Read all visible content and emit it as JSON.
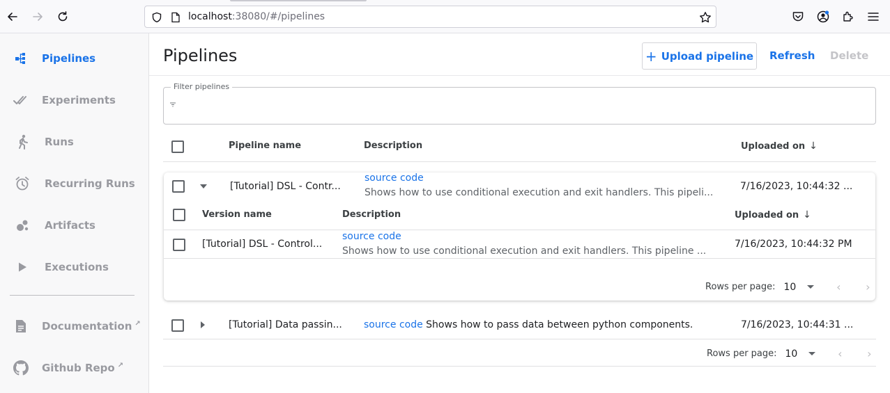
{
  "browser": {
    "url_host": "localhost",
    "url_rest": ":38080/#/pipelines"
  },
  "sidebar": {
    "items": [
      {
        "label": "Pipelines"
      },
      {
        "label": "Experiments"
      },
      {
        "label": "Runs"
      },
      {
        "label": "Recurring Runs"
      },
      {
        "label": "Artifacts"
      },
      {
        "label": "Executions"
      },
      {
        "label": "Documentation"
      },
      {
        "label": "Github Repo"
      }
    ]
  },
  "header": {
    "title": "Pipelines",
    "upload_label": "Upload pipeline",
    "refresh_label": "Refresh",
    "delete_label": "Delete"
  },
  "filter": {
    "legend": "Filter pipelines",
    "value": ""
  },
  "table": {
    "columns": {
      "name": "Pipeline name",
      "description": "Description",
      "uploaded": "Uploaded on"
    },
    "rows": [
      {
        "name": "[Tutorial] DSL - Contr...",
        "link": "source code",
        "description": "Shows how to use conditional execution and exit handlers. This pipeli...",
        "uploaded": "7/16/2023, 10:44:32 ..."
      },
      {
        "name": "[Tutorial] Data passin...",
        "link": "source code",
        "description": "Shows how to pass data between python components.",
        "uploaded": "7/16/2023, 10:44:31 ..."
      }
    ],
    "pager": {
      "label": "Rows per page:",
      "value": "10"
    }
  },
  "versions": {
    "columns": {
      "name": "Version name",
      "description": "Description",
      "uploaded": "Uploaded on"
    },
    "rows": [
      {
        "name": "[Tutorial] DSL - Control...",
        "link": "source code",
        "description": "Shows how to use conditional execution and exit handlers. This pipeline ...",
        "uploaded": "7/16/2023, 10:44:32 PM"
      }
    ],
    "pager": {
      "label": "Rows per page:",
      "value": "10"
    }
  },
  "colors": {
    "accent": "#1a73e8",
    "muted": "#999aa0"
  }
}
